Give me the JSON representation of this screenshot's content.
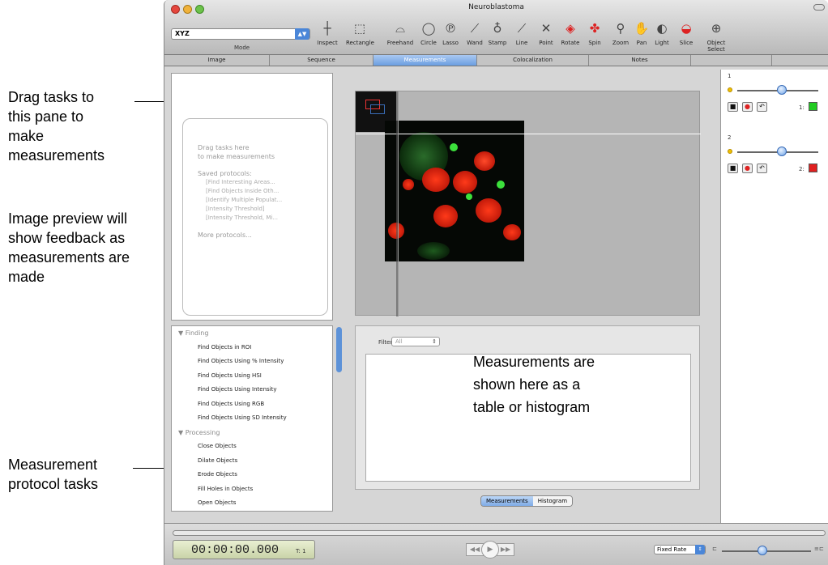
{
  "annotations": [
    {
      "lines": [
        "Drag tasks to",
        "this pane to",
        "make",
        "measurements"
      ]
    },
    {
      "lines": [
        "Image preview will",
        "show feedback as",
        "measurements are",
        "made"
      ]
    },
    {
      "lines": [
        "Measurement",
        "protocol tasks"
      ]
    }
  ],
  "measurement_overlay": [
    "Measurements are",
    "shown here as a",
    "table or histogram"
  ],
  "window": {
    "title": "Neuroblastoma"
  },
  "mode": {
    "value": "XYZ",
    "label": "Mode"
  },
  "toolbar": [
    {
      "label": "Inspect",
      "icon": "crosshair-icon",
      "glyph": "┼"
    },
    {
      "label": "Rectangle",
      "icon": "rectangle-icon",
      "glyph": "⬚"
    },
    {
      "label": "Freehand",
      "icon": "freehand-icon",
      "glyph": "⌓"
    },
    {
      "label": "Circle",
      "icon": "circle-icon",
      "glyph": "◯"
    },
    {
      "label": "Lasso",
      "icon": "lasso-icon",
      "glyph": "℗"
    },
    {
      "label": "Wand",
      "icon": "wand-icon",
      "glyph": "⟋"
    },
    {
      "label": "Stamp",
      "icon": "stamp-icon",
      "glyph": "♁"
    },
    {
      "label": "Line",
      "icon": "line-icon",
      "glyph": "⟋"
    },
    {
      "label": "Point",
      "icon": "point-icon",
      "glyph": "✕"
    },
    {
      "label": "Rotate",
      "icon": "rotate-icon",
      "glyph": "◈"
    },
    {
      "label": "Spin",
      "icon": "spin-icon",
      "glyph": "✤"
    },
    {
      "label": "Zoom",
      "icon": "zoom-icon",
      "glyph": "⚲"
    },
    {
      "label": "Pan",
      "icon": "hand-icon",
      "glyph": "✋"
    },
    {
      "label": "Light",
      "icon": "light-icon",
      "glyph": "◐"
    },
    {
      "label": "Slice",
      "icon": "slice-icon",
      "glyph": "◒"
    },
    {
      "label": "Object Select",
      "icon": "object-select-icon",
      "glyph": "⊕"
    }
  ],
  "tabs": [
    "Image",
    "Sequence",
    "Measurements",
    "Colocalization",
    "Notes"
  ],
  "active_tab": "Measurements",
  "protocol_pane": {
    "hint": [
      "Drag tasks here",
      "to make measurements"
    ],
    "saved_label": "Saved protocols:",
    "saved": [
      "[Find Interesting Areas...",
      "[Find Objects Inside Oth...",
      "[Identify Multiple Populat...",
      "[Intensity Threshold]",
      "[Intensity Threshold, Mi..."
    ],
    "more": "More protocols..."
  },
  "task_tree": [
    {
      "type": "group",
      "label": "▼ Finding"
    },
    {
      "type": "item",
      "label": "Find Objects in ROI"
    },
    {
      "type": "item",
      "label": "Find Objects Using % Intensity"
    },
    {
      "type": "item",
      "label": "Find Objects Using HSI"
    },
    {
      "type": "item",
      "label": "Find Objects Using Intensity"
    },
    {
      "type": "item",
      "label": "Find Objects Using RGB"
    },
    {
      "type": "item",
      "label": "Find Objects Using SD Intensity"
    },
    {
      "type": "group",
      "label": "▼ Processing"
    },
    {
      "type": "item",
      "label": "Close Objects"
    },
    {
      "type": "item",
      "label": "Dilate Objects"
    },
    {
      "type": "item",
      "label": "Erode Objects"
    },
    {
      "type": "item",
      "label": "Fill Holes in Objects"
    },
    {
      "type": "item",
      "label": "Open Objects"
    }
  ],
  "filter": {
    "label": "Filter:",
    "value": "All"
  },
  "results_toggle": [
    "Measurements",
    "Histogram"
  ],
  "results_active": "Measurements",
  "channels": [
    {
      "name": "1",
      "index_label": "1:",
      "color": "#22cc22"
    },
    {
      "name": "2",
      "index_label": "2:",
      "color": "#e02020"
    }
  ],
  "slider_levels": [
    0.55,
    0.55
  ],
  "playback": {
    "timecode": "00:00:00.000",
    "frame": "T: 1",
    "rate": "Fixed Rate",
    "position": 0.45
  },
  "colors": {
    "accent": "#4a86d8",
    "green": "#22cc22",
    "red": "#e02020"
  }
}
